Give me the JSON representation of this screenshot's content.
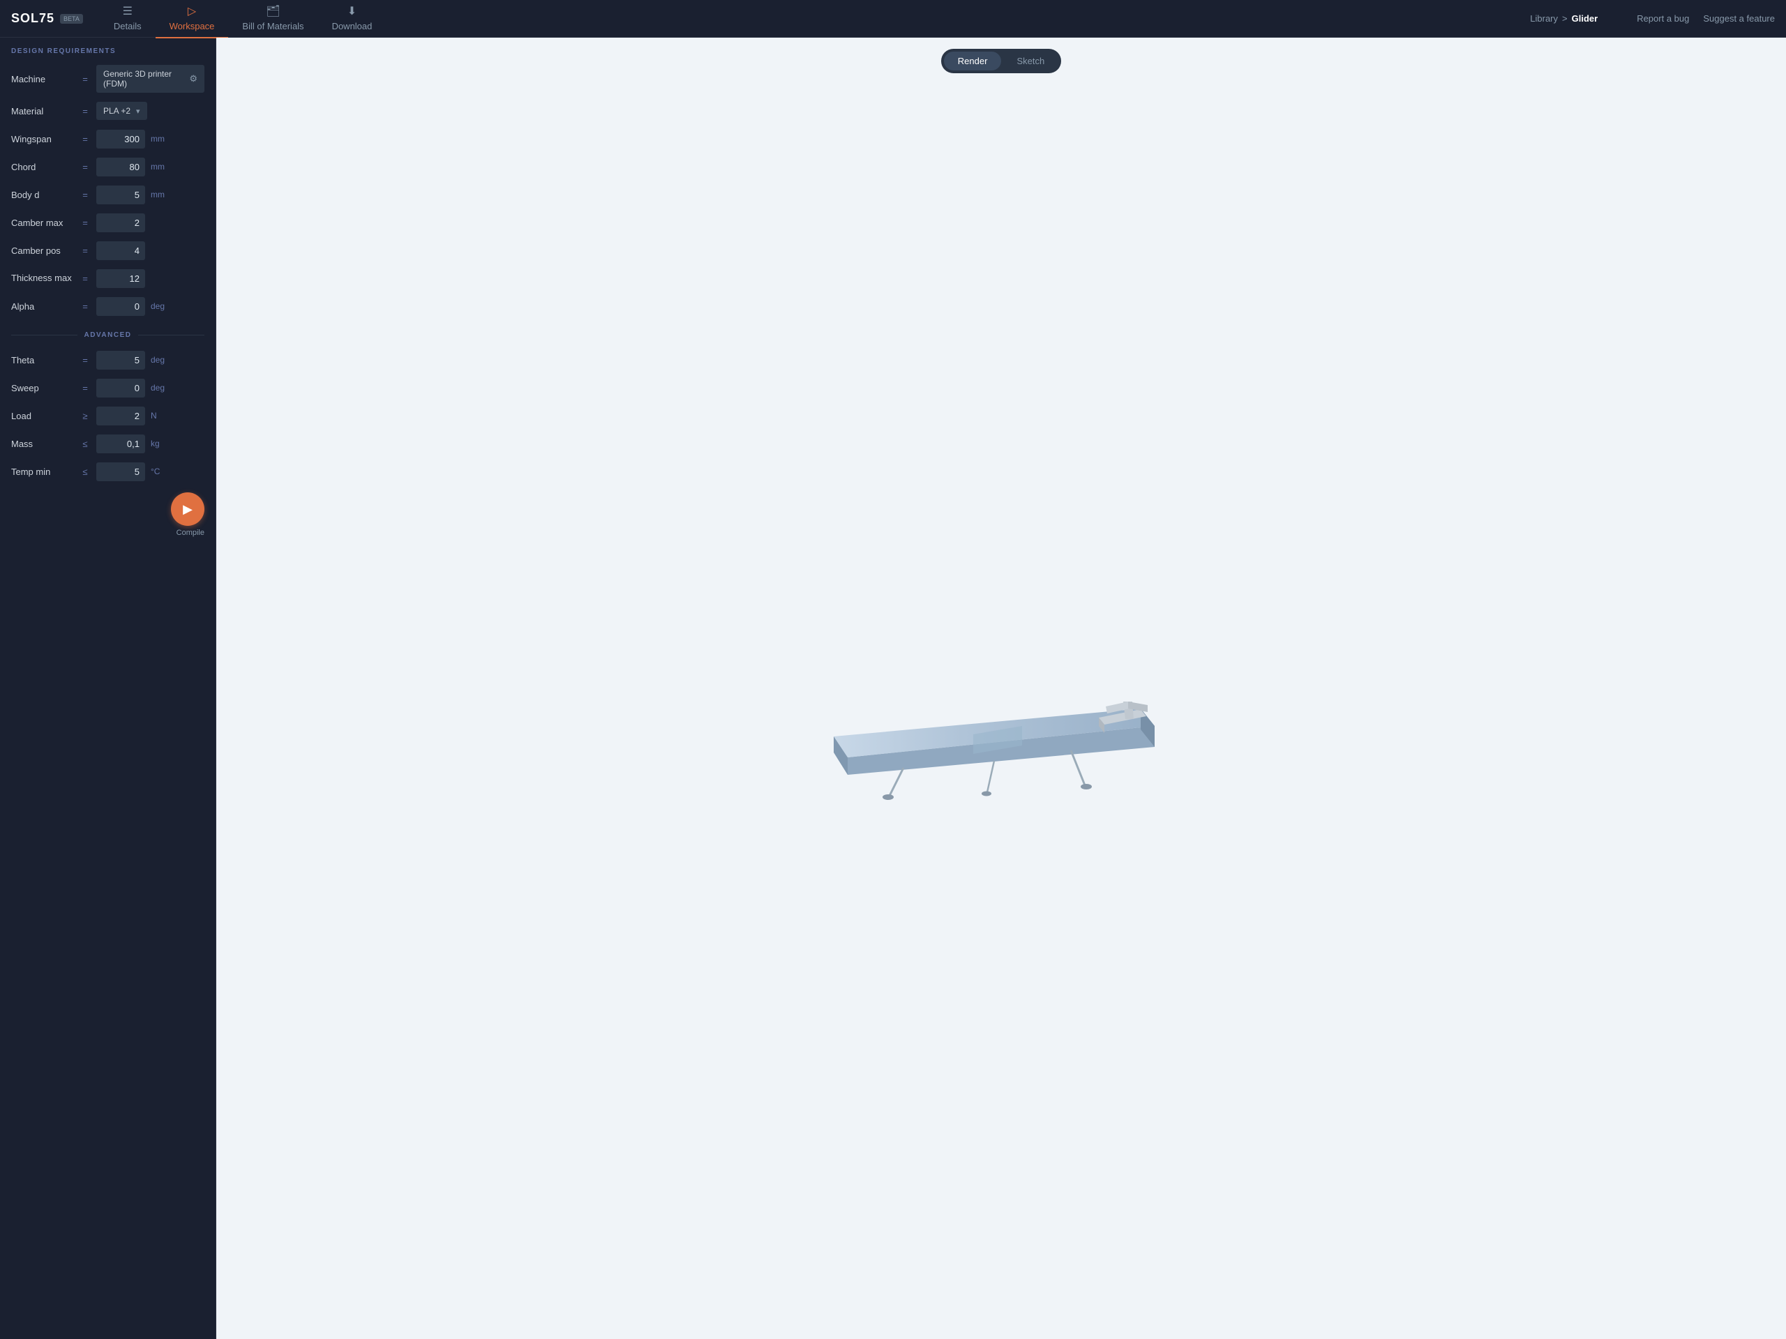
{
  "logo": "SOL75",
  "beta": "BETA",
  "nav": {
    "tabs": [
      {
        "label": "Details",
        "icon": "☰",
        "active": false
      },
      {
        "label": "Workspace",
        "icon": "▷",
        "active": true
      },
      {
        "label": "Bill of Materials",
        "icon": "🛒",
        "active": false
      },
      {
        "label": "Download",
        "icon": "⬇",
        "active": false
      }
    ]
  },
  "breadcrumb": {
    "parent": "Library",
    "separator": ">",
    "current": "Glider"
  },
  "top_links": {
    "report": "Report a bug",
    "suggest": "Suggest a feature"
  },
  "design_requirements": {
    "title": "DESIGN REQUIREMENTS",
    "machine": {
      "label": "Machine",
      "eq": "=",
      "value": "Generic 3D printer (FDM)"
    },
    "material": {
      "label": "Material",
      "eq": "=",
      "value": "PLA +2"
    },
    "params": [
      {
        "label": "Wingspan",
        "eq": "=",
        "value": "300",
        "unit": "mm"
      },
      {
        "label": "Chord",
        "eq": "=",
        "value": "80",
        "unit": "mm"
      },
      {
        "label": "Body d",
        "eq": "=",
        "value": "5",
        "unit": "mm"
      },
      {
        "label": "Camber max",
        "eq": "=",
        "value": "2",
        "unit": ""
      },
      {
        "label": "Camber pos",
        "eq": "=",
        "value": "4",
        "unit": ""
      },
      {
        "label": "Thickness max",
        "eq": "=",
        "value": "12",
        "unit": ""
      },
      {
        "label": "Alpha",
        "eq": "=",
        "value": "0",
        "unit": "deg"
      }
    ]
  },
  "advanced": {
    "title": "ADVANCED",
    "params": [
      {
        "label": "Theta",
        "eq": "=",
        "value": "5",
        "unit": "deg"
      },
      {
        "label": "Sweep",
        "eq": "=",
        "value": "0",
        "unit": "deg"
      },
      {
        "label": "Load",
        "eq": "≥",
        "value": "2",
        "unit": "N"
      },
      {
        "label": "Mass",
        "eq": "≤",
        "value": "0,1",
        "unit": "kg"
      },
      {
        "label": "Temp min",
        "eq": "≤",
        "value": "5",
        "unit": "°C"
      }
    ]
  },
  "compile_label": "Compile",
  "view": {
    "render_label": "Render",
    "sketch_label": "Sketch"
  }
}
